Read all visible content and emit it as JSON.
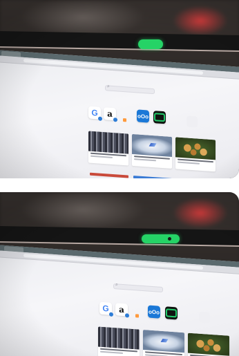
{
  "photos": [
    {
      "id_label": "top",
      "search": {
        "glyph": "⌕"
      },
      "shortcuts_label": "",
      "tiles": [
        {
          "icon": "google-icon",
          "glyph": "G"
        },
        {
          "icon": "amazon-icon",
          "glyph": "a"
        },
        {
          "icon": "blue-app-icon",
          "glyph": "oOo"
        },
        {
          "icon": "green-app-icon",
          "glyph": ""
        }
      ],
      "stories_label": ""
    },
    {
      "id_label": "bottom",
      "search": {
        "glyph": "⌕"
      },
      "shortcuts_label": "",
      "tiles": [
        {
          "icon": "google-icon",
          "glyph": "G"
        },
        {
          "icon": "amazon-icon",
          "glyph": "a"
        },
        {
          "icon": "blue-app-icon",
          "glyph": "oOo"
        },
        {
          "icon": "green-app-icon",
          "glyph": ""
        }
      ],
      "stories_label": ""
    }
  ],
  "colors": {
    "webcam_indicator": "#25d366",
    "tabstrip": "#5b6a6e",
    "screen": "#f4f4f7",
    "bezel": "#151515"
  }
}
